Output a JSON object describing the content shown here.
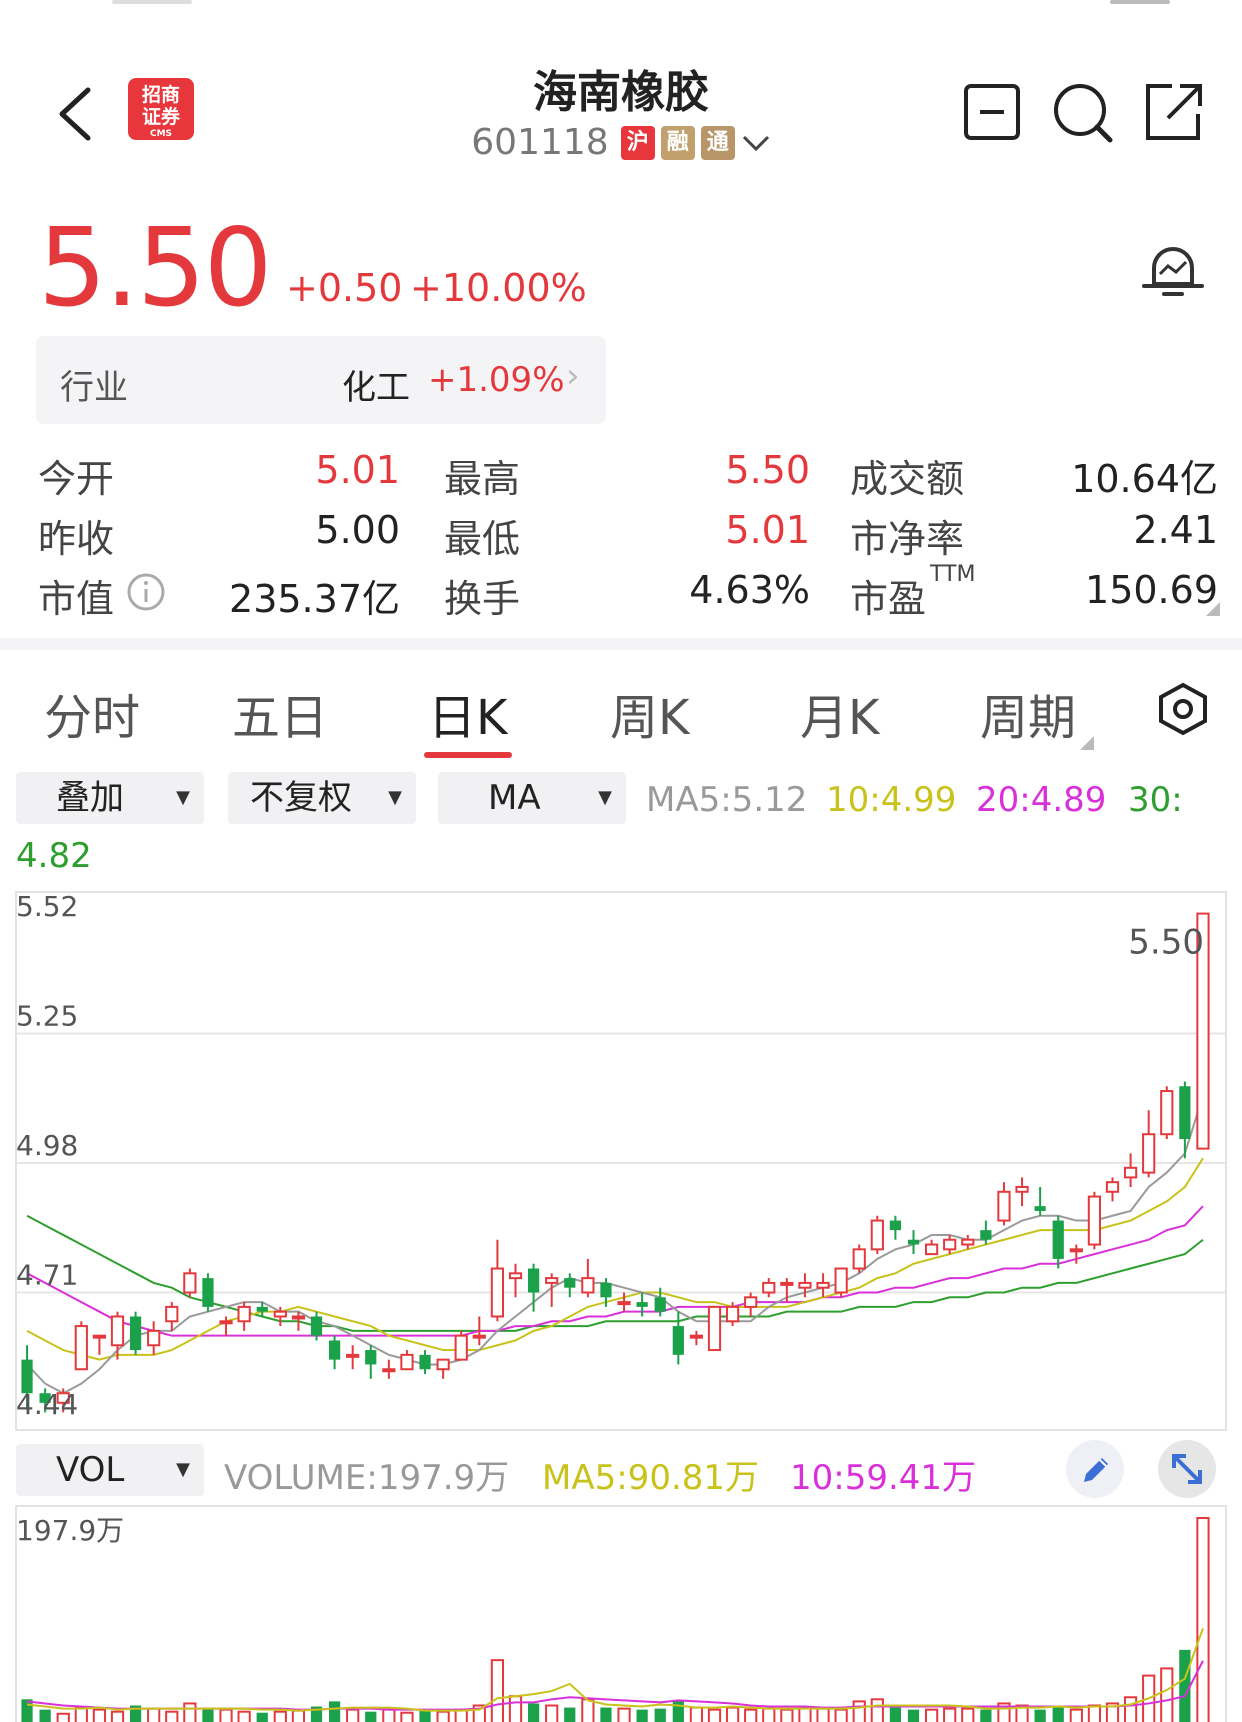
{
  "header": {
    "title": "海南橡胶",
    "code": "601118",
    "badges": [
      "沪",
      "融",
      "通"
    ],
    "logo_text_line1": "招商",
    "logo_text_line2": "证券",
    "logo_sub": "CMS"
  },
  "price": {
    "last": "5.50",
    "change": "+0.50",
    "change_pct": "+10.00%",
    "colors": {
      "up": "#e4393c",
      "down": "#1aa14a"
    }
  },
  "industry": {
    "label": "行业",
    "name": "化工",
    "change_pct": "+1.09%"
  },
  "stats": {
    "open_label": "今开",
    "open": "5.01",
    "high_label": "最高",
    "high": "5.50",
    "amount_label": "成交额",
    "amount": "10.64亿",
    "prev_label": "昨收",
    "prev": "5.00",
    "low_label": "最低",
    "low": "5.01",
    "pb_label": "市净率",
    "pb": "2.41",
    "mcap_label": "市值",
    "mcap": "235.37亿",
    "turnover_label": "换手",
    "turnover": "4.63%",
    "pe_label": "市盈",
    "pe_sup": "TTM",
    "pe": "150.69"
  },
  "tabs": [
    "分时",
    "五日",
    "日K",
    "周K",
    "月K",
    "周期"
  ],
  "active_tab": "日K",
  "controls": {
    "overlay": "叠加",
    "adjust": "不复权",
    "indicator": "MA",
    "ma5": "MA5:5.12",
    "ma10": "10:4.99",
    "ma20": "20:4.89",
    "ma30_label": "30:",
    "ma30": "4.82",
    "vol_selector": "VOL",
    "volume": "VOLUME:197.9万",
    "vol_ma5": "MA5:90.81万",
    "vol_ma10": "10:59.41万"
  },
  "chart_data": {
    "type": "candlestick",
    "y_ticks": [
      "5.52",
      "5.25",
      "4.98",
      "4.71",
      "4.44"
    ],
    "ylim": [
      4.44,
      5.52
    ],
    "last_label": "5.50",
    "volume_max_label": "197.9万",
    "ma_colors": {
      "ma5": "#9a9a9a",
      "ma10": "#c8c21a",
      "ma20": "#d930d9",
      "ma30": "#2e9e2e"
    },
    "candles": [
      [
        4.57,
        4.6,
        4.47,
        4.5
      ],
      [
        4.5,
        4.51,
        4.46,
        4.48
      ],
      [
        4.48,
        4.51,
        4.46,
        4.5
      ],
      [
        4.55,
        4.65,
        4.55,
        4.64
      ],
      [
        4.62,
        4.62,
        4.58,
        4.62
      ],
      [
        4.6,
        4.67,
        4.57,
        4.66
      ],
      [
        4.66,
        4.67,
        4.58,
        4.59
      ],
      [
        4.6,
        4.65,
        4.58,
        4.63
      ],
      [
        4.65,
        4.69,
        4.63,
        4.68
      ],
      [
        4.71,
        4.76,
        4.7,
        4.75
      ],
      [
        4.74,
        4.75,
        4.67,
        4.68
      ],
      [
        4.65,
        4.66,
        4.62,
        4.65
      ],
      [
        4.65,
        4.69,
        4.63,
        4.68
      ],
      [
        4.68,
        4.69,
        4.66,
        4.67
      ],
      [
        4.66,
        4.68,
        4.64,
        4.67
      ],
      [
        4.66,
        4.67,
        4.63,
        4.66
      ],
      [
        4.66,
        4.67,
        4.61,
        4.62
      ],
      [
        4.61,
        4.62,
        4.55,
        4.57
      ],
      [
        4.58,
        4.6,
        4.55,
        4.58
      ],
      [
        4.59,
        4.6,
        4.53,
        4.56
      ],
      [
        4.55,
        4.57,
        4.53,
        4.55
      ],
      [
        4.55,
        4.59,
        4.55,
        4.58
      ],
      [
        4.58,
        4.59,
        4.54,
        4.55
      ],
      [
        4.55,
        4.57,
        4.53,
        4.57
      ],
      [
        4.57,
        4.63,
        4.57,
        4.62
      ],
      [
        4.62,
        4.66,
        4.6,
        4.62
      ],
      [
        4.66,
        4.82,
        4.65,
        4.76
      ],
      [
        4.74,
        4.77,
        4.7,
        4.75
      ],
      [
        4.76,
        4.77,
        4.67,
        4.71
      ],
      [
        4.73,
        4.75,
        4.68,
        4.74
      ],
      [
        4.74,
        4.75,
        4.7,
        4.72
      ],
      [
        4.71,
        4.78,
        4.7,
        4.74
      ],
      [
        4.73,
        4.74,
        4.68,
        4.7
      ],
      [
        4.69,
        4.71,
        4.67,
        4.69
      ],
      [
        4.69,
        4.71,
        4.66,
        4.68
      ],
      [
        4.7,
        4.72,
        4.66,
        4.67
      ],
      [
        4.64,
        4.67,
        4.56,
        4.58
      ],
      [
        4.62,
        4.63,
        4.6,
        4.62
      ],
      [
        4.59,
        4.68,
        4.59,
        4.68
      ],
      [
        4.65,
        4.69,
        4.64,
        4.68
      ],
      [
        4.68,
        4.71,
        4.66,
        4.7
      ],
      [
        4.71,
        4.74,
        4.7,
        4.73
      ],
      [
        4.73,
        4.74,
        4.69,
        4.73
      ],
      [
        4.72,
        4.75,
        4.7,
        4.73
      ],
      [
        4.72,
        4.75,
        4.7,
        4.73
      ],
      [
        4.71,
        4.76,
        4.7,
        4.76
      ],
      [
        4.76,
        4.81,
        4.75,
        4.8
      ],
      [
        4.8,
        4.87,
        4.79,
        4.86
      ],
      [
        4.86,
        4.87,
        4.82,
        4.84
      ],
      [
        4.82,
        4.84,
        4.79,
        4.81
      ],
      [
        4.79,
        4.82,
        4.79,
        4.81
      ],
      [
        4.8,
        4.83,
        4.79,
        4.82
      ],
      [
        4.81,
        4.83,
        4.8,
        4.82
      ],
      [
        4.84,
        4.86,
        4.81,
        4.82
      ],
      [
        4.86,
        4.94,
        4.85,
        4.92
      ],
      [
        4.92,
        4.95,
        4.89,
        4.93
      ],
      [
        4.89,
        4.93,
        4.87,
        4.88
      ],
      [
        4.86,
        4.87,
        4.76,
        4.78
      ],
      [
        4.8,
        4.81,
        4.77,
        4.8
      ],
      [
        4.81,
        4.92,
        4.8,
        4.91
      ],
      [
        4.92,
        4.95,
        4.9,
        4.94
      ],
      [
        4.95,
        5.0,
        4.93,
        4.97
      ],
      [
        4.96,
        5.09,
        4.95,
        5.04
      ],
      [
        5.04,
        5.14,
        5.03,
        5.13
      ],
      [
        5.14,
        5.15,
        4.99,
        5.03
      ],
      [
        5.01,
        5.5,
        5.01,
        5.5
      ]
    ],
    "ma5": [
      4.56,
      4.52,
      4.5,
      4.52,
      4.55,
      4.59,
      4.62,
      4.63,
      4.63,
      4.66,
      4.67,
      4.68,
      4.69,
      4.69,
      4.67,
      4.67,
      4.65,
      4.64,
      4.62,
      4.6,
      4.58,
      4.57,
      4.56,
      4.56,
      4.57,
      4.59,
      4.63,
      4.66,
      4.69,
      4.72,
      4.74,
      4.73,
      4.73,
      4.72,
      4.71,
      4.7,
      4.67,
      4.65,
      4.65,
      4.65,
      4.65,
      4.68,
      4.7,
      4.71,
      4.72,
      4.73,
      4.75,
      4.78,
      4.8,
      4.81,
      4.83,
      4.83,
      4.82,
      4.82,
      4.84,
      4.86,
      4.87,
      4.87,
      4.86,
      4.86,
      4.87,
      4.88,
      4.93,
      4.96,
      5.0,
      5.12
    ],
    "ma10": [
      4.63,
      4.61,
      4.59,
      4.58,
      4.57,
      4.58,
      4.58,
      4.58,
      4.59,
      4.61,
      4.63,
      4.65,
      4.66,
      4.67,
      4.67,
      4.68,
      4.67,
      4.66,
      4.65,
      4.64,
      4.62,
      4.61,
      4.6,
      4.59,
      4.59,
      4.59,
      4.6,
      4.61,
      4.63,
      4.64,
      4.66,
      4.68,
      4.69,
      4.7,
      4.71,
      4.71,
      4.7,
      4.69,
      4.69,
      4.68,
      4.68,
      4.68,
      4.68,
      4.69,
      4.7,
      4.71,
      4.72,
      4.74,
      4.75,
      4.77,
      4.78,
      4.79,
      4.8,
      4.81,
      4.82,
      4.83,
      4.84,
      4.84,
      4.84,
      4.84,
      4.85,
      4.86,
      4.88,
      4.9,
      4.93,
      4.99
    ],
    "ma20": [
      4.75,
      4.73,
      4.71,
      4.69,
      4.67,
      4.65,
      4.64,
      4.63,
      4.62,
      4.62,
      4.62,
      4.62,
      4.62,
      4.62,
      4.62,
      4.62,
      4.62,
      4.62,
      4.62,
      4.62,
      4.62,
      4.62,
      4.62,
      4.62,
      4.62,
      4.63,
      4.63,
      4.64,
      4.64,
      4.65,
      4.65,
      4.66,
      4.66,
      4.67,
      4.67,
      4.67,
      4.68,
      4.68,
      4.68,
      4.68,
      4.69,
      4.69,
      4.69,
      4.69,
      4.7,
      4.7,
      4.71,
      4.71,
      4.72,
      4.72,
      4.73,
      4.74,
      4.74,
      4.75,
      4.76,
      4.76,
      4.77,
      4.77,
      4.78,
      4.79,
      4.8,
      4.81,
      4.82,
      4.84,
      4.85,
      4.89
    ],
    "ma30": [
      4.87,
      4.85,
      4.83,
      4.81,
      4.79,
      4.77,
      4.75,
      4.73,
      4.72,
      4.7,
      4.69,
      4.68,
      4.67,
      4.66,
      4.65,
      4.65,
      4.64,
      4.64,
      4.63,
      4.63,
      4.63,
      4.63,
      4.63,
      4.63,
      4.63,
      4.63,
      4.63,
      4.63,
      4.64,
      4.64,
      4.64,
      4.64,
      4.65,
      4.65,
      4.65,
      4.65,
      4.65,
      4.66,
      4.66,
      4.66,
      4.66,
      4.66,
      4.67,
      4.67,
      4.67,
      4.67,
      4.68,
      4.68,
      4.68,
      4.69,
      4.69,
      4.7,
      4.7,
      4.71,
      4.71,
      4.72,
      4.72,
      4.73,
      4.73,
      4.74,
      4.75,
      4.76,
      4.77,
      4.78,
      4.79,
      4.82
    ],
    "volume": [
      22,
      12,
      8,
      14,
      12,
      10,
      16,
      13,
      10,
      18,
      14,
      12,
      10,
      9,
      10,
      11,
      15,
      20,
      12,
      10,
      12,
      9,
      11,
      10,
      12,
      16,
      60,
      25,
      18,
      16,
      14,
      22,
      14,
      13,
      12,
      13,
      20,
      14,
      12,
      14,
      12,
      13,
      12,
      14,
      13,
      12,
      20,
      22,
      14,
      12,
      12,
      13,
      13,
      12,
      18,
      16,
      12,
      14,
      12,
      16,
      18,
      24,
      45,
      52,
      70,
      197.9
    ],
    "vol_ma5": [
      17,
      15,
      13,
      13,
      14,
      12,
      13,
      13,
      13,
      13,
      13,
      13,
      13,
      12,
      12,
      11,
      12,
      13,
      14,
      14,
      14,
      13,
      11,
      11,
      11,
      12,
      23,
      25,
      27,
      30,
      37,
      21,
      17,
      16,
      15,
      17,
      16,
      14,
      14,
      15,
      14,
      13,
      13,
      13,
      13,
      13,
      14,
      16,
      16,
      16,
      16,
      16,
      15,
      13,
      13,
      14,
      14,
      15,
      14,
      15,
      15,
      17,
      23,
      31,
      42,
      90.81
    ],
    "vol_ma10": [
      20,
      18,
      16,
      15,
      14,
      13,
      13,
      13,
      13,
      13,
      13,
      13,
      13,
      13,
      13,
      12,
      12,
      13,
      13,
      13,
      12,
      12,
      12,
      12,
      12,
      13,
      17,
      19,
      19,
      22,
      24,
      23,
      22,
      21,
      20,
      19,
      21,
      20,
      19,
      18,
      16,
      15,
      15,
      15,
      14,
      14,
      15,
      15,
      15,
      15,
      15,
      15,
      15,
      15,
      15,
      15,
      15,
      15,
      15,
      15,
      15,
      16,
      18,
      21,
      25,
      59.41
    ]
  }
}
